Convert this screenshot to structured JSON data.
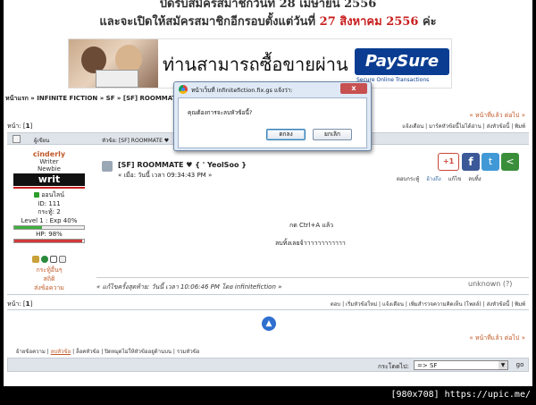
{
  "announcement": {
    "line1": "ปิดรับสมัครสมาชิกวันที่ 28 เมษายน 2556",
    "line2_prefix": "และจะเปิดให้สมัครสมาชิกอีกรอบตั้งแต่วันที่",
    "line2_date": "27 สิงหาคม 2556",
    "line2_suffix": "ค่ะ"
  },
  "banner": {
    "text": "ท่านสามารถซื้อขายผ่าน",
    "logo": "PaySure",
    "tagline": "Secure Online Transactions"
  },
  "breadcrumb": "หน้าแรก » INFINITE FICTION » SF » [SF] ROOMMATE ♥",
  "nav_prev_next": "« หน้าที่แล้ว ต่อไป »",
  "pages_label": "หน้า:",
  "current_page": "1",
  "toolbar_top": "แจ้งเตือน | มาร์คหัวข้อนี้ไม่ได้อ่าน | ส่งหัวข้อนี้ | พิมพ์",
  "header": {
    "author": "ผู้เขียน",
    "topic": "หัวข้อ: [SF] ROOMMATE ♥"
  },
  "user": {
    "name": "cinderly",
    "rank": "Writer",
    "subrank": "Newbie",
    "badge": "writ",
    "status": "ออนไลน์",
    "id": "ID: 111",
    "posts": "กระทู้: 2",
    "level": "Level 1 : Exp 40%",
    "exp_fraction": 0.4,
    "hp": "HP: 98%",
    "hp_fraction": 0.98,
    "links": [
      "กระทู้อื่นๆ",
      "สถิติ",
      "ส่งข้อความ"
    ]
  },
  "post": {
    "title": "[SF] ROOMMATE ♥ { ' YeolSoo }",
    "date": "« เมื่อ: วันนี้ เวลา 09:34:43 PM »",
    "actions": [
      "ตอบกระทู้",
      "อ้างถึง",
      "แก้ไข",
      "ลบทิ้ง"
    ],
    "body_line1": "กด Ctrl+A แล้ว",
    "body_line2": "ลบทิ้งเลยจ้าาาาาาาาาาาา",
    "edit_note": "« แก้ไขครั้งสุดท้าย: วันนี้ เวลา 10:06:46 PM โดย infinitefiction »",
    "unknown_label": "unknown (?)"
  },
  "share": {
    "gplus": "+1",
    "facebook": "f",
    "twitter": "t",
    "share": "<"
  },
  "toolbar_bottom": "ตอบ | เริ่มหัวข้อใหม่ | แจ้งเตือน | เพิ่มสำรวจความคิดเห็น (โพลล์) | ส่งหัวข้อนี้ | พิมพ์",
  "mod_links": {
    "items": [
      "ย้ายข้อความ",
      "ลบหัวข้อ",
      "ล็อคหัวข้อ",
      "ปิดหมุดไม่ให้หัวข้ออยู่ด้านบน",
      "รวมหัวข้อ"
    ]
  },
  "jump": {
    "label": "กระโดดไป:",
    "selected": "=> SF",
    "go": "go"
  },
  "dialog": {
    "title": "หน้าเว็บที่ infinitefiction.fix.gs แจ้งว่า:",
    "close": "x",
    "message": "คุณต้องการจะลบหัวข้อนี้?",
    "ok": "ตกลง",
    "cancel": "ยกเลิก"
  },
  "watermark": "[980x708] https://upic.me/",
  "colors": {
    "accent": "#c05a2a",
    "announce_red": "#c81e1e",
    "paysure_blue": "#0a3d91",
    "dialog_bg": "#dfe9f5"
  }
}
